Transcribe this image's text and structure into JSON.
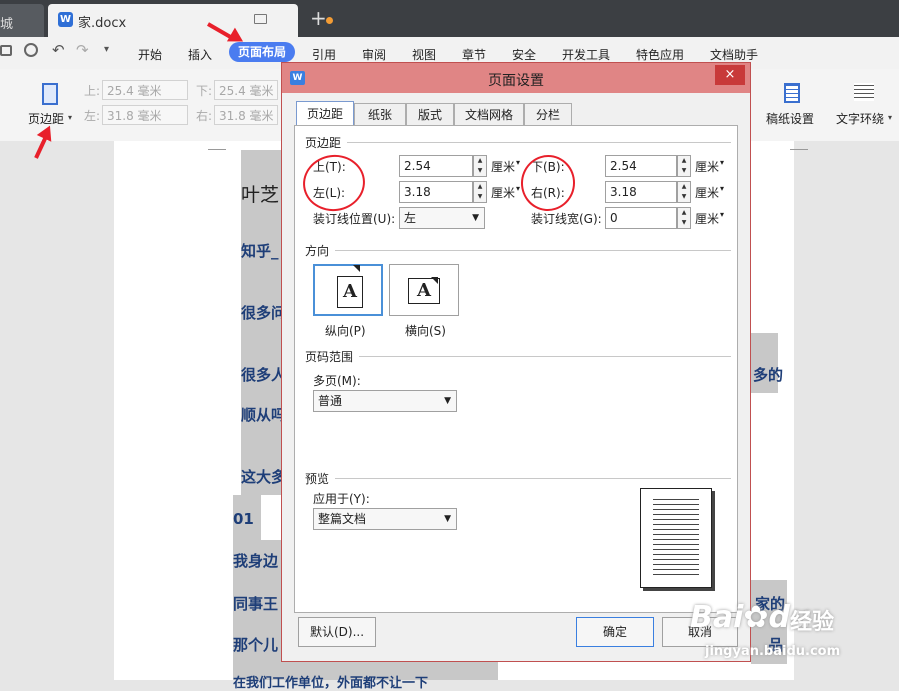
{
  "titlebar": {
    "prev_tab": "城",
    "doc_tab": "家.docx",
    "new_tab": "+"
  },
  "menu": [
    "开始",
    "插入",
    "页面布局",
    "引用",
    "审阅",
    "视图",
    "章节",
    "安全",
    "开发工具",
    "特色应用",
    "文档助手"
  ],
  "ribbon": {
    "margin_button": "页边距",
    "top_label": "上:",
    "top_value": "25.4 毫米",
    "bottom_label": "下:",
    "bottom_value": "25.4 毫米",
    "left_label": "左:",
    "left_value": "31.8 毫米",
    "right_label": "右:",
    "right_value": "31.8 毫米",
    "grid_paper": "稿纸设置",
    "text_wrap": "文字环绕"
  },
  "document": {
    "lines": [
      "叶芝",
      "知乎_",
      "很多问",
      "很多人",
      "多的",
      "顺从吗",
      "这大多",
      "01",
      "我身边",
      "同事王",
      "那个儿",
      "家的",
      "品",
      "在我们工作单位，外面都不让一下"
    ]
  },
  "dialog": {
    "title": "页面设置",
    "close": "×",
    "tabs": [
      "页边距",
      "纸张",
      "版式",
      "文档网格",
      "分栏"
    ],
    "margins": {
      "section": "页边距",
      "top_label": "上(T):",
      "top_value": "2.54",
      "bottom_label": "下(B):",
      "bottom_value": "2.54",
      "left_label": "左(L):",
      "left_value": "3.18",
      "right_label": "右(R):",
      "right_value": "3.18",
      "gutter_pos_label": "装订线位置(U):",
      "gutter_pos_value": "左",
      "gutter_width_label": "装订线宽(G):",
      "gutter_width_value": "0",
      "unit": "厘米"
    },
    "orientation": {
      "section": "方向",
      "portrait": "纵向(P)",
      "landscape": "横向(S)",
      "glyph": "A"
    },
    "page_range": {
      "section": "页码范围",
      "multi_label": "多页(M):",
      "multi_value": "普通"
    },
    "preview": {
      "section": "预览",
      "apply_label": "应用于(Y):",
      "apply_value": "整篇文档"
    },
    "buttons": {
      "default": "默认(D)...",
      "ok": "确定",
      "cancel": "取消"
    }
  },
  "watermark": {
    "brand": "Bai",
    "brand2": "du",
    "exp": "经验",
    "url": "jingyan.baidu.com"
  },
  "colors": {
    "accent": "#4a7cf0",
    "dialog_title": "#e08585",
    "annotation": "#e8202b"
  }
}
